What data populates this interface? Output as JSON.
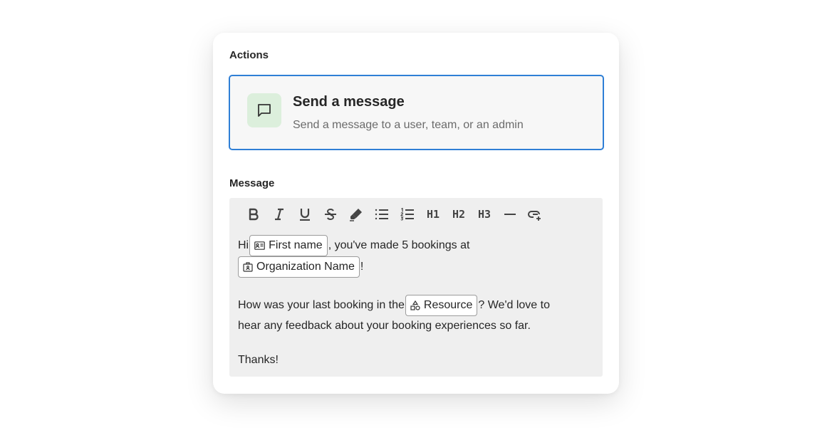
{
  "actions": {
    "label": "Actions",
    "card": {
      "icon": "message-square-icon",
      "title": "Send a message",
      "subtitle": "Send a message to a user, team, or an admin",
      "accent_color": "#2f7fd6",
      "icon_bg": "#dcefdc"
    }
  },
  "message": {
    "label": "Message",
    "toolbar": {
      "h1": "H1",
      "h2": "H2",
      "h3": "H3"
    },
    "body": {
      "greeting": "Hi ",
      "first_name_chip": "First name",
      "after_first_name": ", you've made 5 bookings at",
      "org_chip": "Organization Name",
      "after_org": "!",
      "question_pre": "How was your last booking in the ",
      "resource_chip": "Resource",
      "question_post": "? We'd love to",
      "question_line2": "hear any feedback about your booking experiences so far.",
      "signoff": "Thanks!"
    }
  }
}
